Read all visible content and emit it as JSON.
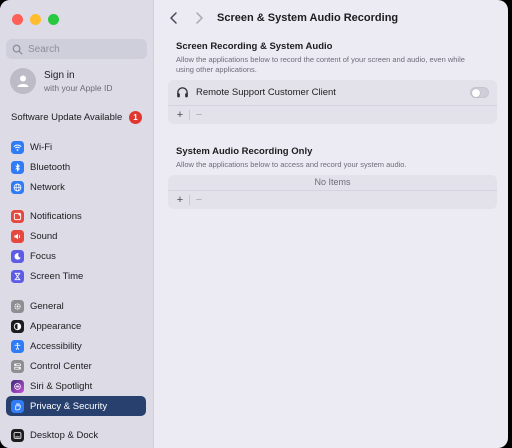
{
  "window": {
    "controls": [
      "close",
      "minimize",
      "zoom"
    ]
  },
  "sidebar": {
    "search_placeholder": "Search",
    "account": {
      "title": "Sign in",
      "subtitle": "with your Apple ID"
    },
    "update": {
      "label": "Software Update Available",
      "badge": "1"
    },
    "items": [
      {
        "label": "Wi-Fi",
        "icon": "wifi-icon",
        "color": "#2f7cf6"
      },
      {
        "label": "Bluetooth",
        "icon": "bluetooth-icon",
        "color": "#2f7cf6"
      },
      {
        "label": "Network",
        "icon": "globe-icon",
        "color": "#2f7cf6"
      },
      {
        "label": "Notifications",
        "icon": "bell-icon",
        "color": "#e5483f"
      },
      {
        "label": "Sound",
        "icon": "speaker-icon",
        "color": "#e5483f"
      },
      {
        "label": "Focus",
        "icon": "moon-icon",
        "color": "#5e5ce6"
      },
      {
        "label": "Screen Time",
        "icon": "hourglass-icon",
        "color": "#5e5ce6"
      },
      {
        "label": "General",
        "icon": "gear-icon",
        "color": "#8e8e93"
      },
      {
        "label": "Appearance",
        "icon": "appearance-icon",
        "color": "#1c1c1e"
      },
      {
        "label": "Accessibility",
        "icon": "accessibility-icon",
        "color": "#2f7cf6"
      },
      {
        "label": "Control Center",
        "icon": "control-center-icon",
        "color": "#8e8e93"
      },
      {
        "label": "Siri & Spotlight",
        "icon": "siri-icon",
        "color": "#6a4fd8"
      },
      {
        "label": "Privacy & Security",
        "icon": "hand-icon",
        "color": "#2f7cf6",
        "active": true
      },
      {
        "label": "Desktop & Dock",
        "icon": "dock-icon",
        "color": "#1c1c1e"
      }
    ]
  },
  "toolbar": {
    "title": "Screen & System Audio Recording"
  },
  "sections": [
    {
      "title": "Screen Recording & System Audio",
      "description": "Allow the applications below to record the content of your screen and audio, even while using other applications.",
      "apps": [
        {
          "name": "Remote Support Customer Client",
          "icon": "headphones-icon",
          "enabled": false
        }
      ],
      "add_label": "+",
      "remove_label": "−"
    },
    {
      "title": "System Audio Recording Only",
      "description": "Allow the applications below to access and record your system audio.",
      "empty_text": "No Items",
      "add_label": "+",
      "remove_label": "−"
    }
  ]
}
